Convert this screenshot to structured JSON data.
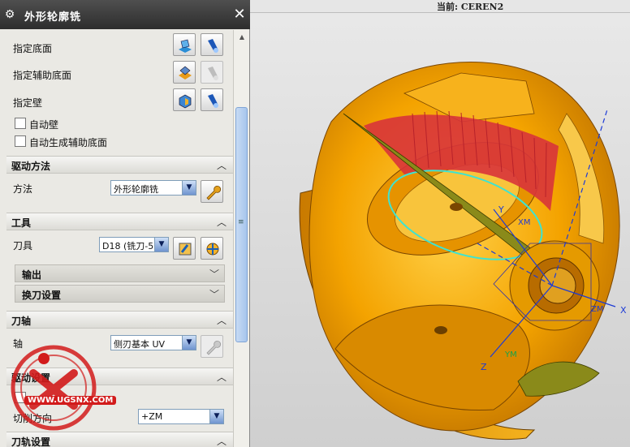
{
  "dialog": {
    "title": "外形轮廓铣",
    "specify_floor": "指定底面",
    "specify_aux_floor": "指定辅助底面",
    "specify_wall": "指定壁",
    "auto_wall": "自动壁",
    "auto_aux_floor": "自动生成辅助底面",
    "drive_method": {
      "header": "驱动方法",
      "method_label": "方法",
      "method_value": "外形轮廓铣"
    },
    "tool": {
      "header": "工具",
      "tool_label": "刀具",
      "tool_value": "D18 (铣刀-5",
      "output": "输出",
      "tool_change": "换刀设置"
    },
    "tool_axis": {
      "header": "刀轴",
      "axis_label": "轴",
      "axis_value": "侧刃基本 UV"
    },
    "drive_settings": {
      "header": "驱动设置",
      "cut_label": "切削方向",
      "axis_value": "+ZM"
    },
    "path_settings": {
      "header": "刀轨设置"
    }
  },
  "viewport": {
    "status": "当前: CEREN2",
    "axis_labels": {
      "x": "X",
      "y": "Y",
      "z": "Z",
      "xm": "XM",
      "ym": "YM",
      "zm": "ZM"
    }
  },
  "watermark": {
    "text": "WWW.UGSNX.COM"
  },
  "colors": {
    "part_orange": "#f2a400",
    "cut_region": "#d8343a",
    "titlebar": "#3a3a3a",
    "section_bg": "#eae9e4"
  }
}
